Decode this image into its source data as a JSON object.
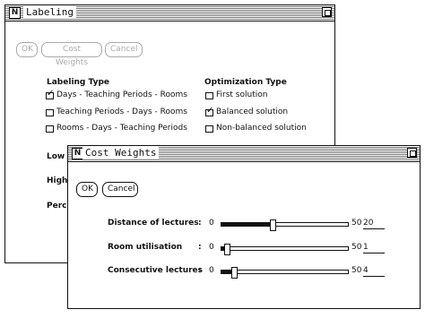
{
  "labeling_window": {
    "title": "Labeling",
    "buttons": {
      "ok": "OK",
      "cost_weights": "Cost Weights",
      "cancel": "Cancel"
    },
    "labeling_type": {
      "heading": "Labeling Type",
      "options": [
        {
          "label": "Days - Teaching Periods - Rooms",
          "checked": true
        },
        {
          "label": "Teaching Periods - Days - Rooms",
          "checked": false
        },
        {
          "label": "Rooms - Days - Teaching Periods",
          "checked": false
        }
      ]
    },
    "optimization_type": {
      "heading": "Optimization Type",
      "options": [
        {
          "label": "First solution",
          "checked": false
        },
        {
          "label": "Balanced solution",
          "checked": true
        },
        {
          "label": "Non-balanced solution",
          "checked": false
        }
      ]
    },
    "side_labels": {
      "low": "Low",
      "high": "High",
      "perce": "Perce"
    }
  },
  "cost_window": {
    "title": "Cost Weights",
    "buttons": {
      "ok": "OK",
      "cancel": "Cancel"
    },
    "sliders": [
      {
        "label": "Distance of lectures",
        "colon": ":",
        "min": "0",
        "max": "50",
        "value": "20",
        "fraction": 0.4
      },
      {
        "label": "Room utilisation",
        "colon": ":",
        "min": "0",
        "max": "50",
        "value": "1",
        "fraction": 0.02
      },
      {
        "label": "Consecutive lectures",
        "colon": ":",
        "min": "0",
        "max": "50",
        "value": "4",
        "fraction": 0.08
      }
    ]
  }
}
